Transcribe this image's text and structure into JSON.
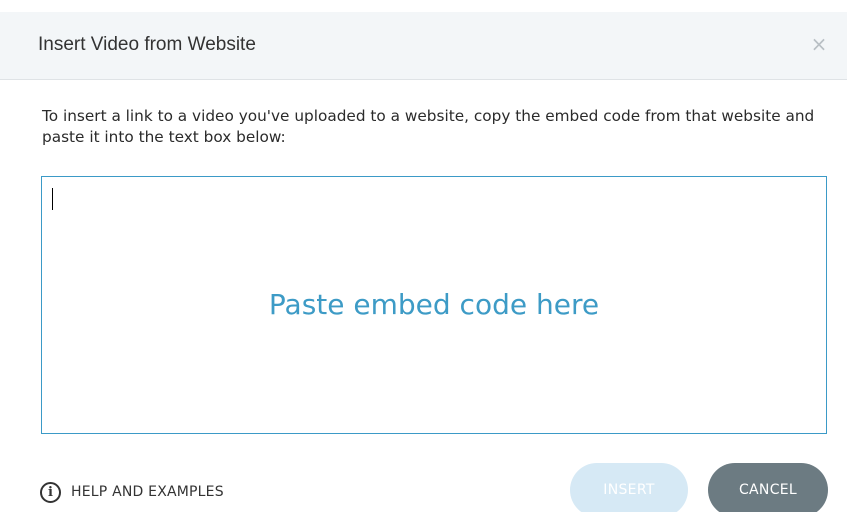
{
  "dialog": {
    "title": "Insert Video from Website",
    "close_glyph": "×",
    "instructions": "To insert a link to a video you've uploaded to a website, copy the embed code from that website and paste it into the text box below:",
    "embed_placeholder": "Paste embed code here",
    "help_label": "HELP AND EXAMPLES",
    "info_glyph": "i",
    "insert_label": "INSERT",
    "cancel_label": "CANCEL"
  },
  "icons": {
    "close": "close-icon",
    "info": "info-icon"
  },
  "colors": {
    "accent": "#3b9ac7",
    "header_bg": "#f3f6f8",
    "insert_disabled_bg": "#d6e9f5",
    "cancel_bg": "#6c7b82"
  }
}
